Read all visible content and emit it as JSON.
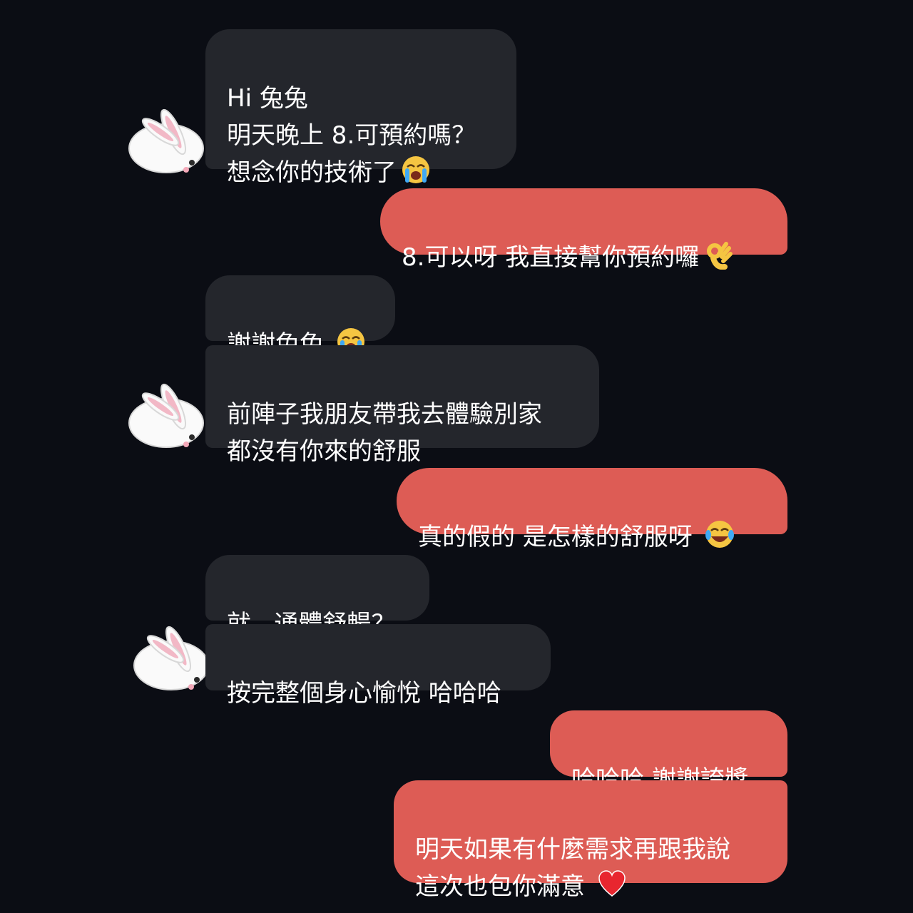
{
  "colors": {
    "background": "#0b0d14",
    "received_bubble": "#24262c",
    "sent_bubble": "#dd5c55",
    "text": "#ffffff"
  },
  "messages": [
    {
      "sender": "contact",
      "text": "Hi 兔兔\n明天晚上 8.可預約嗎？\n想念你的技術了",
      "emoji": "loudly-crying-face"
    },
    {
      "sender": "me",
      "text": "8.可以呀 我直接幫你預約囉",
      "emoji": "ok-hand"
    },
    {
      "sender": "contact",
      "text": "謝謝兔兔 ",
      "emoji": "loudly-crying-face"
    },
    {
      "sender": "contact",
      "text": "前陣子我朋友帶我去體驗別家\n都沒有你來的舒服"
    },
    {
      "sender": "me",
      "text": "真的假的 是怎樣的舒服呀 ",
      "emoji": "tears-of-joy-face"
    },
    {
      "sender": "contact",
      "text": "就...通體舒暢？"
    },
    {
      "sender": "contact",
      "text": "按完整個身心愉悅 哈哈哈"
    },
    {
      "sender": "me",
      "text": "哈哈哈 謝謝誇獎"
    },
    {
      "sender": "me",
      "text": "明天如果有什麼需求再跟我說\n這次也包你滿意 ",
      "emoji": "red-heart"
    }
  ],
  "avatar_icon": "white-rabbit-icon"
}
